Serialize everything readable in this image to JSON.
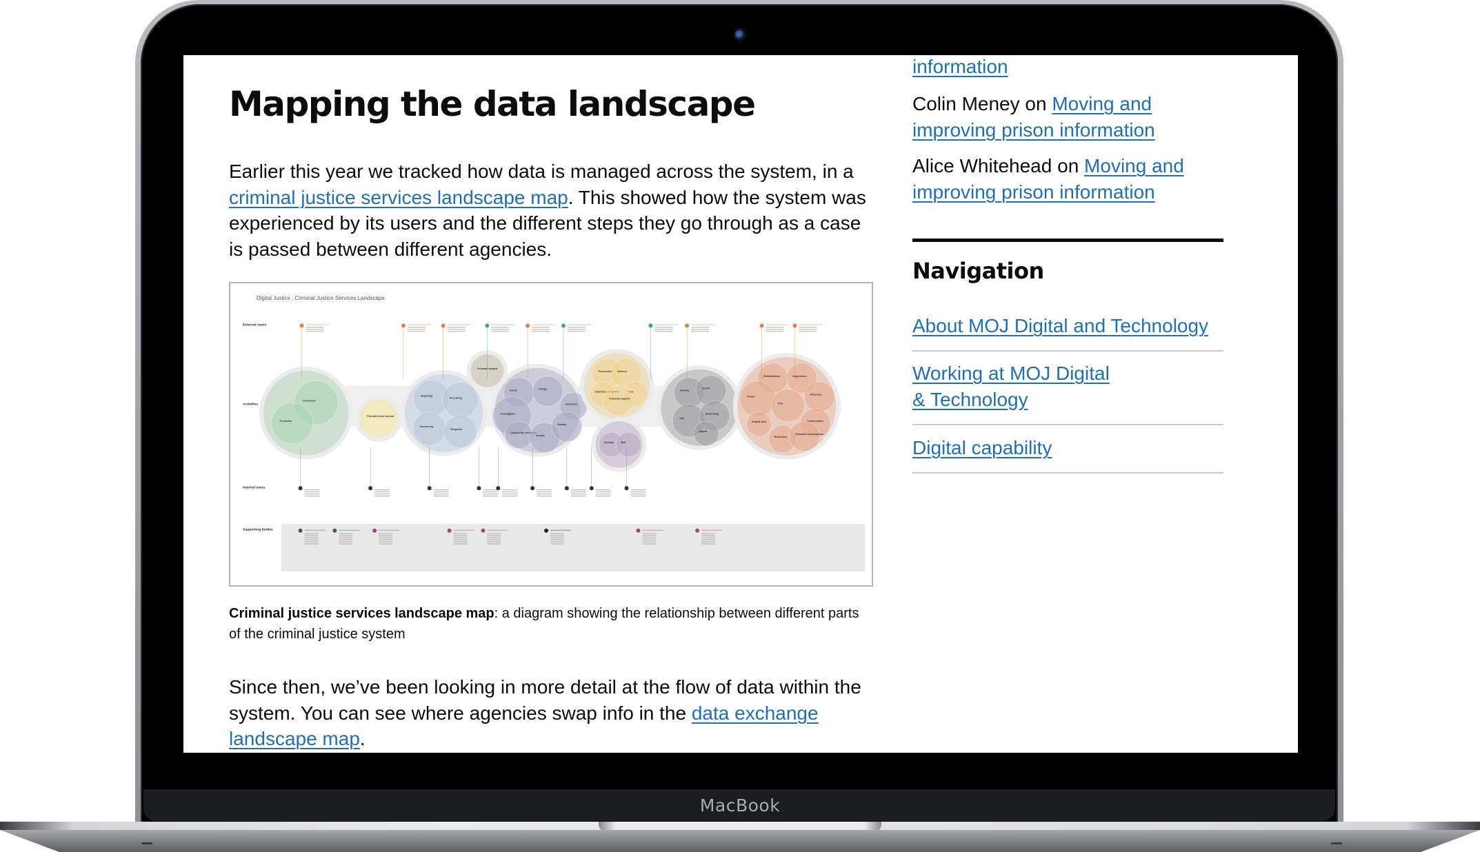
{
  "device": {
    "label": "MacBook"
  },
  "article": {
    "title": "Mapping the data landscape",
    "para1": {
      "before": "Earlier this year we tracked how data is managed across the system, in a ",
      "link": "criminal justice services landscape map",
      "after": ". This showed how the system was experienced by its users and the different steps they go through as a case is passed between different agencies."
    },
    "figure": {
      "alt": "Digital Justice : Criminal Justice Services Landscape",
      "diagram_title": "Digital Justice : Criminal Justice Services Landscape",
      "row_labels": [
        "External users",
        "Activities",
        "Internal users",
        "Supporting bodies"
      ],
      "clusters": [
        {
          "name": "prevention",
          "color": "#a9d3b4",
          "nodes": [
            "Prevention",
            "Protection"
          ]
        },
        {
          "name": "crime",
          "color": "#f3e88a",
          "nodes": [
            "Possible crime and antisocial behaviour"
          ]
        },
        {
          "name": "reporting",
          "color": "#b7c7dd",
          "nodes": [
            "Reporting",
            "Recording",
            "Uncovering",
            "Response"
          ]
        },
        {
          "name": "support",
          "color": "#bdb3a0",
          "nodes": [
            "Personal support"
          ]
        },
        {
          "name": "investigation",
          "color": "#a9a7c4",
          "nodes": [
            "Arrest",
            "Charge",
            "Investigation",
            "Summons",
            "Community resolution",
            "Caution",
            "Penalty"
          ]
        },
        {
          "name": "prosecution",
          "color": "#f0d18e",
          "nodes": [
            "Prosecution",
            "Defence",
            "Indictment or written charge",
            "Plea",
            "Financial support"
          ]
        },
        {
          "name": "custody",
          "color": "#b7a7c4",
          "nodes": [
            "Custody",
            "Bail"
          ]
        },
        {
          "name": "court",
          "color": "#9d9d9f",
          "nodes": [
            "Hearing",
            "Verdict",
            "Trial",
            "Sentencing",
            "Appeal"
          ]
        },
        {
          "name": "sentence",
          "color": "#e6a98a",
          "nodes": [
            "Rehabilitation",
            "Supervision",
            "Prison",
            "Fine",
            "Recovery",
            "Unpaid work",
            "Compensation",
            "Restriction",
            "Education and treatment"
          ]
        }
      ],
      "caption_bold": "Criminal justice services landscape map",
      "caption_rest": ": a diagram showing the relationship between different parts of the criminal justice system"
    },
    "para2": {
      "before": "Since then, we’ve been looking in more detail at the flow of data within the system. You can see where agencies swap info in the ",
      "link": "data exchange landscape map",
      "after": "."
    }
  },
  "sidebar": {
    "comments_tail_link": "information",
    "comments": [
      {
        "author": "Colin Meney",
        "on": " on ",
        "post": "Moving and improving prison information"
      },
      {
        "author": "Alice Whitehead",
        "on": " on ",
        "post": "Moving and improving prison information"
      }
    ],
    "nav_heading": "Navigation",
    "nav_items": [
      {
        "label": "About MOJ Digital and Technology"
      },
      {
        "label": "Working at MOJ Digital & Technology"
      },
      {
        "label": "Digital capability"
      }
    ]
  },
  "colors": {
    "link": "#1d70b8",
    "text": "#0b0c0c",
    "rule": "#c7c9ca"
  }
}
